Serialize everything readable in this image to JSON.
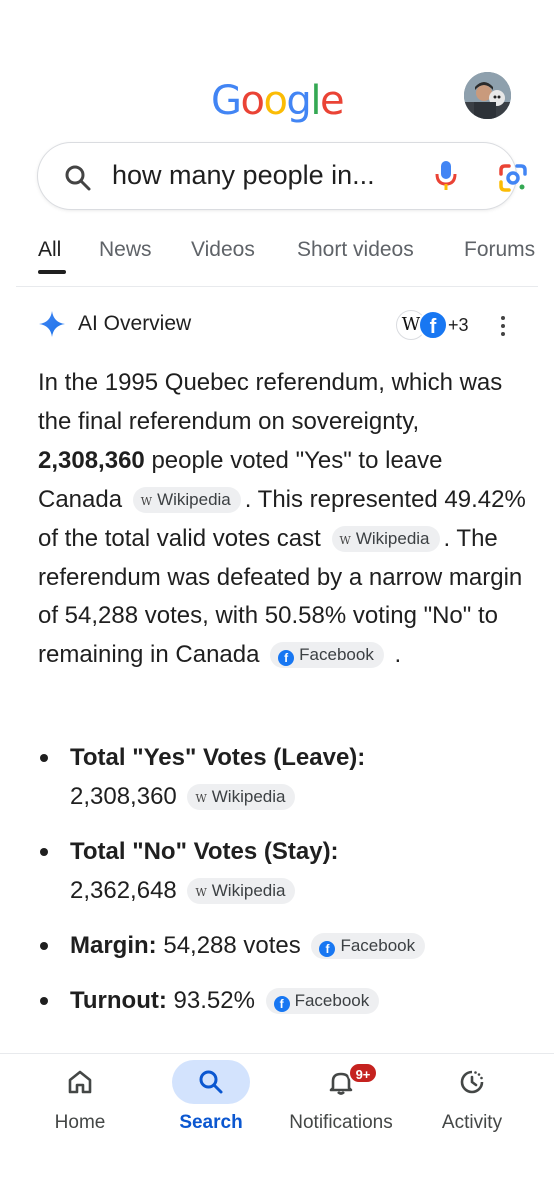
{
  "logo": {
    "text": "Google",
    "letters": [
      "G",
      "o",
      "o",
      "g",
      "l",
      "e"
    ],
    "colors": [
      "#4285F4",
      "#EA4335",
      "#FBBC05",
      "#4285F4",
      "#34A853",
      "#EA4335"
    ]
  },
  "search": {
    "query": "how many people in..."
  },
  "tabs": [
    {
      "label": "All",
      "active": true
    },
    {
      "label": "News"
    },
    {
      "label": "Videos"
    },
    {
      "label": "Short videos"
    },
    {
      "label": "Forums"
    }
  ],
  "ai_overview": {
    "title": "AI Overview",
    "sources_more": "+3",
    "source_icons": [
      "wikipedia-icon",
      "facebook-icon"
    ],
    "paragraph": {
      "p1": "In the 1995 Quebec referendum, which was the final referendum on sovereignty,",
      "bold1": "2,308,360",
      "p2": "people voted \"Yes\" to leave Canada",
      "chip1": "Wikipedia",
      "p3": ". This represented 49.42% of the total valid votes cast",
      "chip2": "Wikipedia",
      "p4": ". The referendum was defeated by a narrow margin of 54,288 votes, with 50.58% voting \"No\" to remaining in Canada",
      "chip3": "Facebook",
      "p5": "."
    },
    "bullets": [
      {
        "label": "Total \"Yes\" Votes (Leave):",
        "value": "2,308,360",
        "source": "Wikipedia",
        "source_icon": "wikipedia-icon"
      },
      {
        "label": "Total \"No\" Votes (Stay):",
        "value": "2,362,648",
        "source": "Wikipedia",
        "source_icon": "wikipedia-icon"
      },
      {
        "label": "Margin:",
        "value": "54,288 votes",
        "source": "Facebook",
        "source_icon": "facebook-icon"
      },
      {
        "label": "Turnout:",
        "value": "93.52%",
        "source": "Facebook",
        "source_icon": "facebook-icon"
      }
    ]
  },
  "bottom_nav": [
    {
      "label": "Home",
      "icon": "home-icon"
    },
    {
      "label": "Search",
      "icon": "search-icon",
      "active": true
    },
    {
      "label": "Notifications",
      "icon": "bell-icon",
      "badge": "9+"
    },
    {
      "label": "Activity",
      "icon": "history-icon"
    }
  ],
  "colors": {
    "accent": "#0b57d0",
    "active_pill": "#d3e3fd",
    "badge": "#c5221f",
    "chip_bg": "#eeeff1"
  }
}
